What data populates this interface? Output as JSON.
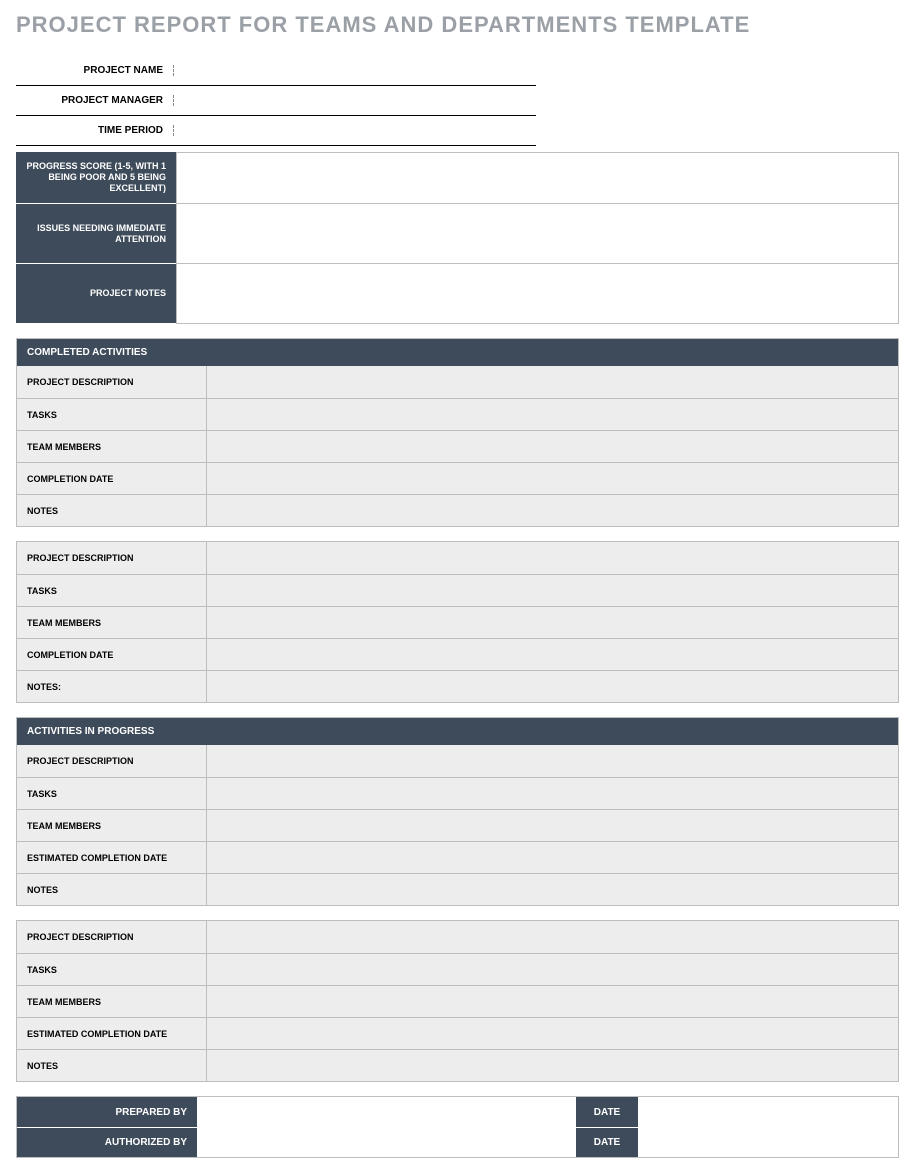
{
  "title": "PROJECT REPORT FOR TEAMS AND DEPARTMENTS TEMPLATE",
  "colors": {
    "dark": "#3e4b5b",
    "title_gray": "#9aa0a6",
    "light_gray": "#ededed",
    "border": "#bdbdbd"
  },
  "info": {
    "project_name": {
      "label": "PROJECT NAME",
      "value": ""
    },
    "project_manager": {
      "label": "PROJECT MANAGER",
      "value": ""
    },
    "time_period": {
      "label": "TIME PERIOD",
      "value": ""
    }
  },
  "header": {
    "progress_score": {
      "label": "PROGRESS SCORE\n(1-5, WITH 1 BEING POOR AND 5 BEING EXCELLENT)",
      "value": ""
    },
    "issues": {
      "label": "ISSUES NEEDING IMMEDIATE ATTENTION",
      "value": ""
    },
    "notes": {
      "label": "PROJECT NOTES",
      "value": ""
    }
  },
  "sections": {
    "completed": {
      "title": "COMPLETED ACTIVITIES",
      "groups": [
        {
          "rows": [
            {
              "label": "PROJECT DESCRIPTION",
              "value": ""
            },
            {
              "label": "TASKS",
              "value": ""
            },
            {
              "label": "TEAM MEMBERS",
              "value": ""
            },
            {
              "label": "COMPLETION DATE",
              "value": ""
            },
            {
              "label": "NOTES",
              "value": ""
            }
          ]
        },
        {
          "rows": [
            {
              "label": "PROJECT DESCRIPTION",
              "value": ""
            },
            {
              "label": "TASKS",
              "value": ""
            },
            {
              "label": "TEAM MEMBERS",
              "value": ""
            },
            {
              "label": "COMPLETION DATE",
              "value": ""
            },
            {
              "label": "NOTES:",
              "value": ""
            }
          ]
        }
      ]
    },
    "in_progress": {
      "title": "ACTIVITIES IN PROGRESS",
      "groups": [
        {
          "rows": [
            {
              "label": "PROJECT DESCRIPTION",
              "value": ""
            },
            {
              "label": "TASKS",
              "value": ""
            },
            {
              "label": "TEAM MEMBERS",
              "value": ""
            },
            {
              "label": "ESTIMATED COMPLETION DATE",
              "value": ""
            },
            {
              "label": "NOTES",
              "value": ""
            }
          ]
        },
        {
          "rows": [
            {
              "label": "PROJECT DESCRIPTION",
              "value": ""
            },
            {
              "label": "TASKS",
              "value": ""
            },
            {
              "label": "TEAM MEMBERS",
              "value": ""
            },
            {
              "label": "ESTIMATED COMPLETION DATE",
              "value": ""
            },
            {
              "label": "NOTES",
              "value": ""
            }
          ]
        }
      ]
    }
  },
  "signoff": {
    "prepared_by": {
      "label": "PREPARED BY",
      "value": "",
      "date_label": "DATE",
      "date_value": ""
    },
    "authorized_by": {
      "label": "AUTHORIZED BY",
      "value": "",
      "date_label": "DATE",
      "date_value": ""
    }
  }
}
